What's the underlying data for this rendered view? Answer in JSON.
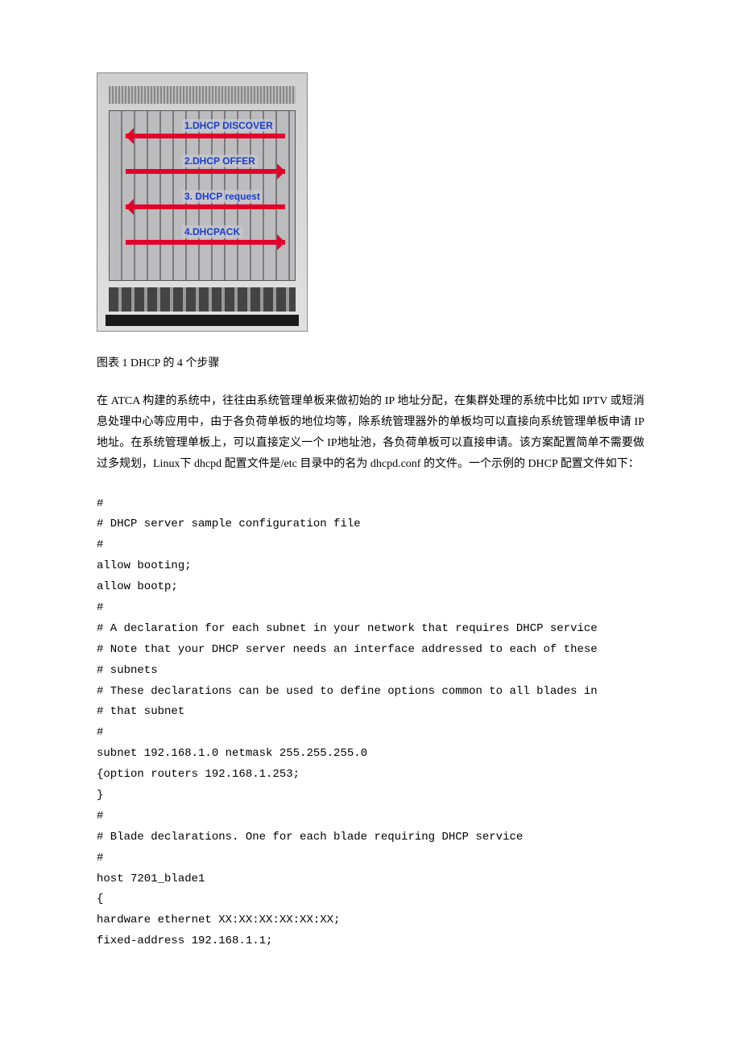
{
  "figure": {
    "steps": [
      {
        "label": "1.DHCP DISCOVER",
        "dir": "l"
      },
      {
        "label": "2.DHCP OFFER",
        "dir": "r"
      },
      {
        "label": "3. DHCP request",
        "dir": "l"
      },
      {
        "label": "4.DHCPACK",
        "dir": "r"
      }
    ]
  },
  "caption": "图表 1 DHCP 的 4 个步骤",
  "paragraph": "在 ATCA 构建的系统中，往往由系统管理单板来做初始的 IP 地址分配，在集群处理的系统中比如 IPTV 或短消息处理中心等应用中，由于各负荷单板的地位均等，除系统管理器外的单板均可以直接向系统管理单板申请 IP 地址。在系统管理单板上，可以直接定义一个 IP地址池，各负荷单板可以直接申请。该方案配置简单不需要做过多规划，Linux下 dhcpd 配置文件是/etc 目录中的名为 dhcpd.conf 的文件。一个示例的 DHCP 配置文件如下：",
  "code_lines": [
    "#",
    "# DHCP server sample configuration file",
    "#",
    "allow booting;",
    "allow bootp;",
    "#",
    "# A declaration for each subnet in your network that requires DHCP service",
    "# Note that your DHCP server needs an interface addressed to each of these",
    "# subnets",
    "# These declarations can be used to define options common to all blades in",
    "# that subnet",
    "#",
    "subnet 192.168.1.0 netmask 255.255.255.0",
    "{option routers 192.168.1.253;",
    "}",
    "#",
    "# Blade declarations. One for each blade requiring DHCP service",
    "#",
    "host 7201_blade1",
    "{",
    "hardware ethernet XX:XX:XX:XX:XX:XX;",
    "fixed-address 192.168.1.1;"
  ]
}
